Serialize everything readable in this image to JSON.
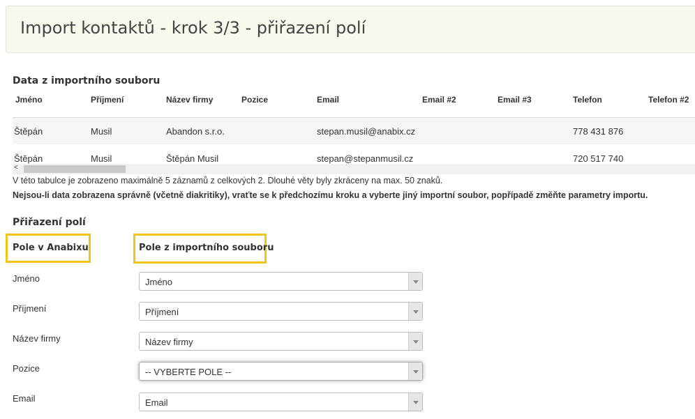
{
  "header": {
    "title": "Import kontaktů - krok 3/3 - přiřazení polí"
  },
  "preview": {
    "title": "Data z importního souboru",
    "columns": [
      "Jméno",
      "Příjmení",
      "Název firmy",
      "Pozice",
      "Email",
      "Email #2",
      "Email #3",
      "Telefon",
      "Telefon #2"
    ],
    "rows": [
      [
        "Štěpán",
        "Musil",
        "Abandon s.r.o.",
        "",
        "stepan.musil@anabix.cz",
        "",
        "",
        "778 431 876",
        ""
      ],
      [
        "Štěpán",
        "Musil",
        "Štěpán Musil",
        "",
        "stepan@stepanmusil.cz",
        "",
        "",
        "720 517 740",
        ""
      ]
    ],
    "scroll_left_arrow": "<",
    "note": "V této tabulce je zobrazeno maximálně 5 záznamů z celkových 2. Dlouhé věty byly zkráceny na max. 50 znaků.",
    "warning": "Nejsou-li data zobrazena správně (včetně diakritiky), vraťte se k předchozímu kroku a vyberte jiný importní soubor, popřípadě změňte parametry importu."
  },
  "mapping": {
    "title": "Přiřazení polí",
    "col_anabix": "Pole v Anabixu",
    "col_import": "Pole z importního souboru",
    "highlight_color": "#f2c418",
    "fields": [
      {
        "label": "Jméno",
        "selected": "Jméno"
      },
      {
        "label": "Příjmení",
        "selected": "Příjmení"
      },
      {
        "label": "Název firmy",
        "selected": "Název firmy"
      },
      {
        "label": "Pozice",
        "selected": "-- VYBERTE POLE --"
      },
      {
        "label": "Email",
        "selected": "Email"
      }
    ]
  }
}
